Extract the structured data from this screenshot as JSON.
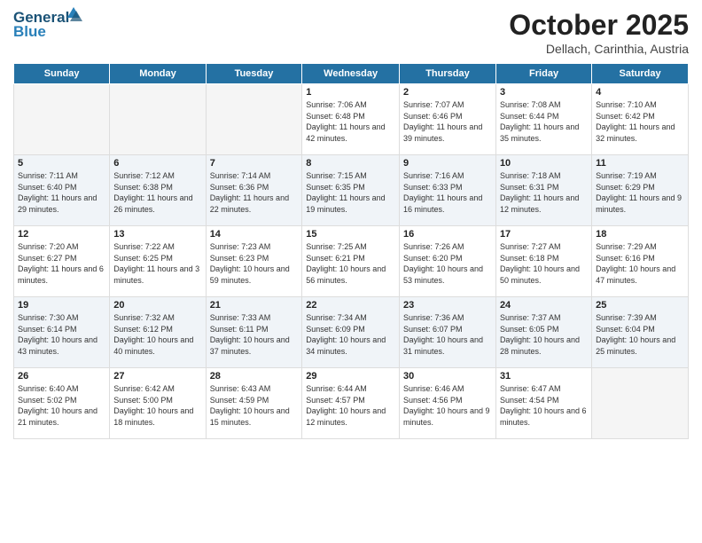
{
  "header": {
    "logo_line1": "General",
    "logo_line2": "Blue",
    "month": "October 2025",
    "location": "Dellach, Carinthia, Austria"
  },
  "days_of_week": [
    "Sunday",
    "Monday",
    "Tuesday",
    "Wednesday",
    "Thursday",
    "Friday",
    "Saturday"
  ],
  "weeks": [
    [
      {
        "day": "",
        "empty": true
      },
      {
        "day": "",
        "empty": true
      },
      {
        "day": "",
        "empty": true
      },
      {
        "day": "1",
        "sunrise": "7:06 AM",
        "sunset": "6:48 PM",
        "daylight": "11 hours and 42 minutes."
      },
      {
        "day": "2",
        "sunrise": "7:07 AM",
        "sunset": "6:46 PM",
        "daylight": "11 hours and 39 minutes."
      },
      {
        "day": "3",
        "sunrise": "7:08 AM",
        "sunset": "6:44 PM",
        "daylight": "11 hours and 35 minutes."
      },
      {
        "day": "4",
        "sunrise": "7:10 AM",
        "sunset": "6:42 PM",
        "daylight": "11 hours and 32 minutes."
      }
    ],
    [
      {
        "day": "5",
        "sunrise": "7:11 AM",
        "sunset": "6:40 PM",
        "daylight": "11 hours and 29 minutes."
      },
      {
        "day": "6",
        "sunrise": "7:12 AM",
        "sunset": "6:38 PM",
        "daylight": "11 hours and 26 minutes."
      },
      {
        "day": "7",
        "sunrise": "7:14 AM",
        "sunset": "6:36 PM",
        "daylight": "11 hours and 22 minutes."
      },
      {
        "day": "8",
        "sunrise": "7:15 AM",
        "sunset": "6:35 PM",
        "daylight": "11 hours and 19 minutes."
      },
      {
        "day": "9",
        "sunrise": "7:16 AM",
        "sunset": "6:33 PM",
        "daylight": "11 hours and 16 minutes."
      },
      {
        "day": "10",
        "sunrise": "7:18 AM",
        "sunset": "6:31 PM",
        "daylight": "11 hours and 12 minutes."
      },
      {
        "day": "11",
        "sunrise": "7:19 AM",
        "sunset": "6:29 PM",
        "daylight": "11 hours and 9 minutes."
      }
    ],
    [
      {
        "day": "12",
        "sunrise": "7:20 AM",
        "sunset": "6:27 PM",
        "daylight": "11 hours and 6 minutes."
      },
      {
        "day": "13",
        "sunrise": "7:22 AM",
        "sunset": "6:25 PM",
        "daylight": "11 hours and 3 minutes."
      },
      {
        "day": "14",
        "sunrise": "7:23 AM",
        "sunset": "6:23 PM",
        "daylight": "10 hours and 59 minutes."
      },
      {
        "day": "15",
        "sunrise": "7:25 AM",
        "sunset": "6:21 PM",
        "daylight": "10 hours and 56 minutes."
      },
      {
        "day": "16",
        "sunrise": "7:26 AM",
        "sunset": "6:20 PM",
        "daylight": "10 hours and 53 minutes."
      },
      {
        "day": "17",
        "sunrise": "7:27 AM",
        "sunset": "6:18 PM",
        "daylight": "10 hours and 50 minutes."
      },
      {
        "day": "18",
        "sunrise": "7:29 AM",
        "sunset": "6:16 PM",
        "daylight": "10 hours and 47 minutes."
      }
    ],
    [
      {
        "day": "19",
        "sunrise": "7:30 AM",
        "sunset": "6:14 PM",
        "daylight": "10 hours and 43 minutes."
      },
      {
        "day": "20",
        "sunrise": "7:32 AM",
        "sunset": "6:12 PM",
        "daylight": "10 hours and 40 minutes."
      },
      {
        "day": "21",
        "sunrise": "7:33 AM",
        "sunset": "6:11 PM",
        "daylight": "10 hours and 37 minutes."
      },
      {
        "day": "22",
        "sunrise": "7:34 AM",
        "sunset": "6:09 PM",
        "daylight": "10 hours and 34 minutes."
      },
      {
        "day": "23",
        "sunrise": "7:36 AM",
        "sunset": "6:07 PM",
        "daylight": "10 hours and 31 minutes."
      },
      {
        "day": "24",
        "sunrise": "7:37 AM",
        "sunset": "6:05 PM",
        "daylight": "10 hours and 28 minutes."
      },
      {
        "day": "25",
        "sunrise": "7:39 AM",
        "sunset": "6:04 PM",
        "daylight": "10 hours and 25 minutes."
      }
    ],
    [
      {
        "day": "26",
        "sunrise": "6:40 AM",
        "sunset": "5:02 PM",
        "daylight": "10 hours and 21 minutes."
      },
      {
        "day": "27",
        "sunrise": "6:42 AM",
        "sunset": "5:00 PM",
        "daylight": "10 hours and 18 minutes."
      },
      {
        "day": "28",
        "sunrise": "6:43 AM",
        "sunset": "4:59 PM",
        "daylight": "10 hours and 15 minutes."
      },
      {
        "day": "29",
        "sunrise": "6:44 AM",
        "sunset": "4:57 PM",
        "daylight": "10 hours and 12 minutes."
      },
      {
        "day": "30",
        "sunrise": "6:46 AM",
        "sunset": "4:56 PM",
        "daylight": "10 hours and 9 minutes."
      },
      {
        "day": "31",
        "sunrise": "6:47 AM",
        "sunset": "4:54 PM",
        "daylight": "10 hours and 6 minutes."
      },
      {
        "day": "",
        "empty": true
      }
    ]
  ],
  "labels": {
    "sunrise": "Sunrise:",
    "sunset": "Sunset:",
    "daylight": "Daylight:"
  }
}
